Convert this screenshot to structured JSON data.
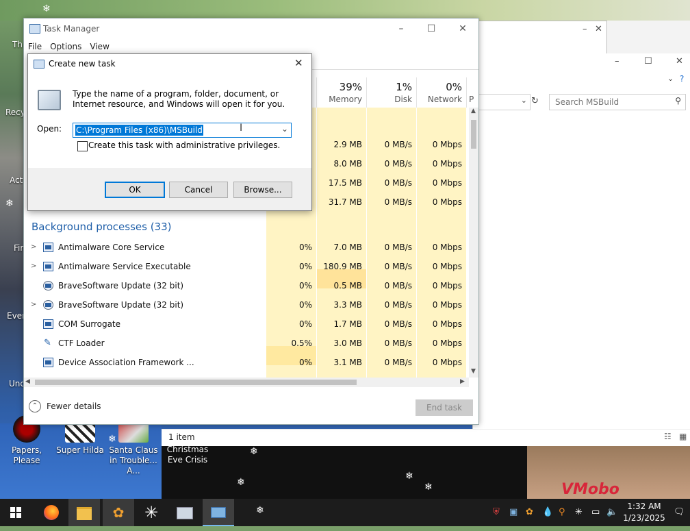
{
  "desktop": {
    "left_labels": [
      "Th",
      "Recy",
      "Act",
      "Fir",
      "Ever",
      "Unc"
    ],
    "icons": [
      {
        "label": "Papers, Please"
      },
      {
        "label": "Super Hilda"
      },
      {
        "label": "Santa Claus in Trouble... A..."
      },
      {
        "label": "Christmas Eve Crisis"
      }
    ],
    "watermark": "VMobo"
  },
  "explorer": {
    "search_placeholder": "Search MSBuild",
    "status_items": "1 item"
  },
  "task_manager": {
    "title": "Task Manager",
    "menu": [
      "File",
      "Options",
      "View"
    ],
    "columns": [
      {
        "pct": "",
        "name": ""
      },
      {
        "pct": "39%",
        "name": "Memory"
      },
      {
        "pct": "1%",
        "name": "Disk"
      },
      {
        "pct": "0%",
        "name": "Network"
      }
    ],
    "app_rows": [
      {
        "cpu": "",
        "memory": "2.9 MB",
        "disk": "0 MB/s",
        "network": "0 Mbps"
      },
      {
        "cpu": "",
        "memory": "8.0 MB",
        "disk": "0 MB/s",
        "network": "0 Mbps"
      },
      {
        "cpu": "",
        "memory": "17.5 MB",
        "disk": "0 MB/s",
        "network": "0 Mbps"
      },
      {
        "cpu": "",
        "memory": "31.7 MB",
        "disk": "0 MB/s",
        "network": "0 Mbps"
      }
    ],
    "background_title": "Background processes (33)",
    "bg_rows": [
      {
        "name": "Antimalware Core Service",
        "expand": true,
        "cpu": "0%",
        "memory": "7.0 MB",
        "disk": "0 MB/s",
        "network": "0 Mbps"
      },
      {
        "name": "Antimalware Service Executable",
        "expand": true,
        "cpu": "0%",
        "memory": "180.9 MB",
        "disk": "0 MB/s",
        "network": "0 Mbps"
      },
      {
        "name": "BraveSoftware Update (32 bit)",
        "expand": false,
        "cpu": "0%",
        "memory": "0.5 MB",
        "disk": "0 MB/s",
        "network": "0 Mbps"
      },
      {
        "name": "BraveSoftware Update (32 bit)",
        "expand": true,
        "cpu": "0%",
        "memory": "3.3 MB",
        "disk": "0 MB/s",
        "network": "0 Mbps"
      },
      {
        "name": "COM Surrogate",
        "expand": false,
        "cpu": "0%",
        "memory": "1.7 MB",
        "disk": "0 MB/s",
        "network": "0 Mbps"
      },
      {
        "name": "CTF Loader",
        "expand": false,
        "cpu": "0.5%",
        "memory": "3.0 MB",
        "disk": "0 MB/s",
        "network": "0 Mbps"
      },
      {
        "name": "Device Association Framework ...",
        "expand": false,
        "cpu": "0%",
        "memory": "3.1 MB",
        "disk": "0 MB/s",
        "network": "0 Mbps"
      }
    ],
    "fewer_details": "Fewer details",
    "end_task": "End task"
  },
  "run_dialog": {
    "title": "Create new task",
    "description": "Type the name of a program, folder, document, or Internet resource, and Windows will open it for you.",
    "open_label": "Open:",
    "open_value": "C:\\Program Files (x86)\\MSBuild",
    "admin_label": "Create this task with administrative privileges.",
    "ok": "OK",
    "cancel": "Cancel",
    "browse": "Browse..."
  },
  "taskbar": {
    "time": "1:32 AM",
    "date": "1/23/2025"
  },
  "colors": {
    "accent": "#0078d7",
    "heat_light": "#fff4c4",
    "heat_mid": "#ffe9a0",
    "section_blue": "#1e5ea8"
  }
}
